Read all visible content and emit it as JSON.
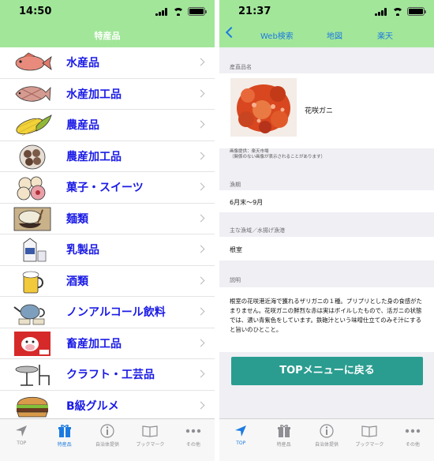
{
  "left": {
    "status_time": "14:50",
    "title": "特産品",
    "items": [
      {
        "label": "水産品",
        "icon": "red-snapper-icon",
        "color": "#e07a6a"
      },
      {
        "label": "水産加工品",
        "icon": "dried-fish-icon",
        "color": "#c98a80"
      },
      {
        "label": "農産品",
        "icon": "corn-icon",
        "color": "#8fb93a"
      },
      {
        "label": "農産加工品",
        "icon": "dried-fruit-basket-icon",
        "color": "#7b5a48"
      },
      {
        "label": "菓子・スイーツ",
        "icon": "sweets-icon",
        "color": "#e9c7a0"
      },
      {
        "label": "麺類",
        "icon": "noodle-bowl-icon",
        "color": "#8a6a52"
      },
      {
        "label": "乳製品",
        "icon": "milk-carton-icon",
        "color": "#e8e8f0"
      },
      {
        "label": "酒類",
        "icon": "beer-mug-icon",
        "color": "#f2c93a"
      },
      {
        "label": "ノンアルコール飲料",
        "icon": "teapot-icon",
        "color": "#6a8fb0"
      },
      {
        "label": "畜産加工品",
        "icon": "beef-cow-icon",
        "color": "#d62a2a"
      },
      {
        "label": "クラフト・工芸品",
        "icon": "chair-table-icon",
        "color": "#555555"
      },
      {
        "label": "B級グルメ",
        "icon": "hamburger-icon",
        "color": "#c07a3a"
      }
    ]
  },
  "right": {
    "status_time": "21:37",
    "nav": {
      "web_search": "Web検索",
      "map": "地図",
      "rakuten": "楽天"
    },
    "product_name_header": "産直品名",
    "product_name": "花咲ガニ",
    "image_credit_line1": "画像提供：楽天市場",
    "image_credit_line2": "（関係のない画像が表示されることがあります）",
    "season_header": "漁期",
    "season": "6月末〜9月",
    "area_header": "主な漁域／水揚げ漁港",
    "area": "根室",
    "description_header": "説明",
    "description": "根室の花咲港近海で獲れるザリガニの１種。プリプリとした身の食感がたまりません。花咲ガニの鮮烈な赤は実はボイルしたもので、活ガニの状態では、濃い青紫色をしています。鉄砲汁という味噌仕立てのみそ汁にすると旨いのひとこと。",
    "top_button": "TOPメニューに戻る"
  },
  "tabs": [
    {
      "label": "TOP",
      "icon": "location-arrow-icon"
    },
    {
      "label": "特産品",
      "icon": "gift-icon"
    },
    {
      "label": "自治体提供",
      "icon": "info-icon"
    },
    {
      "label": "ブックマーク",
      "icon": "book-icon"
    },
    {
      "label": "その他",
      "icon": "more-dots-icon"
    }
  ],
  "colors": {
    "nav_green": "#a2e69a",
    "accent_blue": "#1d7be0",
    "list_text": "#1a1ae6",
    "button_teal": "#2a9d90"
  }
}
